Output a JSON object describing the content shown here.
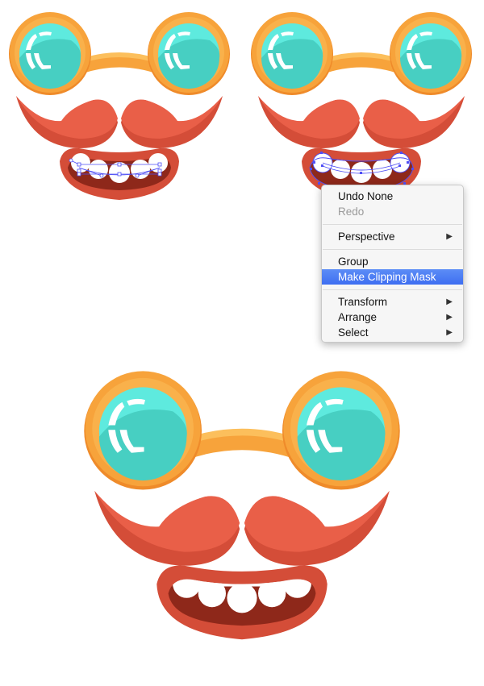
{
  "colors": {
    "frame_orange": "#f7a33b",
    "frame_orange_light": "#fcbf5c",
    "frame_orange_dark": "#ef8b2a",
    "lens_light": "#5eeade",
    "lens_dark": "#47cfc2",
    "glare": "#ffffff",
    "mustache": "#e95f48",
    "mustache_shadow": "#d44d38",
    "lip": "#d44d38",
    "mouth_inner": "#8e281a",
    "teeth": "#ffffff",
    "selection": "#4f4ff5",
    "menu_highlight": "#4a7af3"
  },
  "illustrations": [
    {
      "label": "face-step-teeth-selected",
      "selection_mode": "partial"
    },
    {
      "label": "face-step-mask-selection",
      "selection_mode": "full"
    },
    {
      "label": "face-result-clipped",
      "selection_mode": "none"
    }
  ],
  "context_menu": {
    "items": [
      {
        "label": "Undo None",
        "enabled": true
      },
      {
        "label": "Redo",
        "enabled": false
      },
      {
        "separator": true
      },
      {
        "label": "Perspective",
        "submenu": true,
        "arrow": "▶"
      },
      {
        "separator": true
      },
      {
        "label": "Group",
        "enabled": true
      },
      {
        "label": "Make Clipping Mask",
        "highlighted": true
      },
      {
        "separator": true
      },
      {
        "label": "Transform",
        "submenu": true,
        "arrow": "▶"
      },
      {
        "label": "Arrange",
        "submenu": true,
        "arrow": "▶"
      },
      {
        "label": "Select",
        "submenu": true,
        "arrow": "▶"
      }
    ]
  }
}
